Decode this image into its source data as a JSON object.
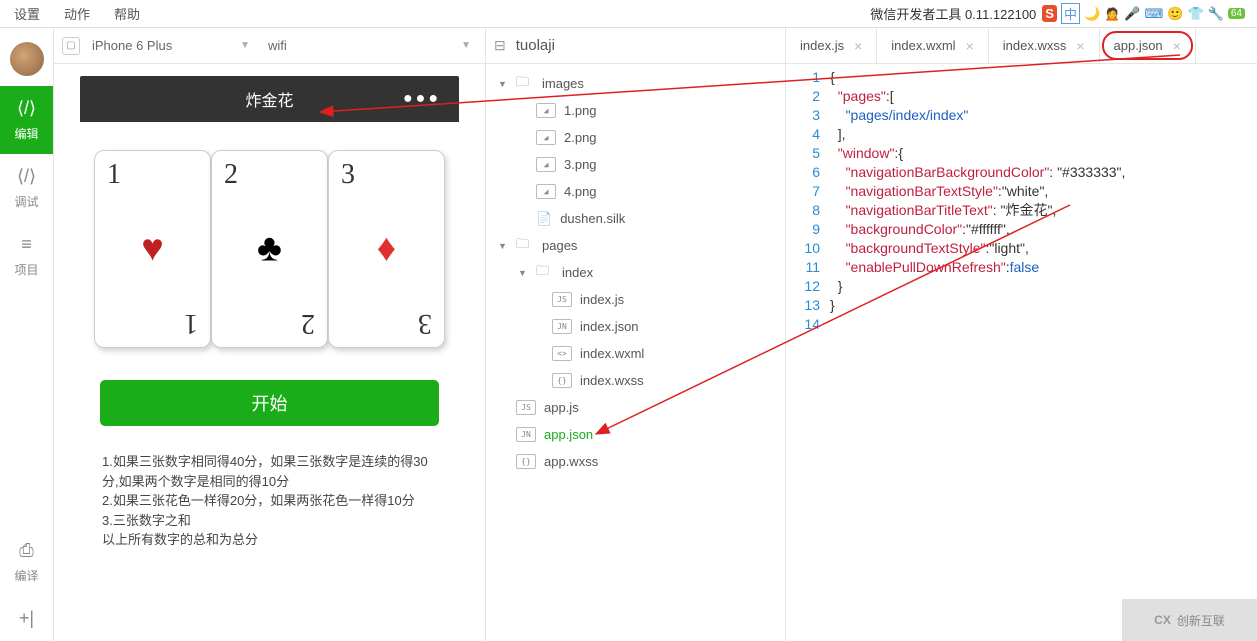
{
  "menubar": {
    "settings": "设置",
    "action": "动作",
    "help": "帮助",
    "title_info": "微信开发者工具 0.11.122100"
  },
  "sidebar": {
    "edit": "编辑",
    "debug": "调试",
    "project": "项目",
    "compile": "编译"
  },
  "preview": {
    "device": "iPhone 6 Plus",
    "network": "wifi"
  },
  "phone": {
    "title": "炸金花",
    "start_btn": "开始"
  },
  "cards": [
    {
      "num": "1",
      "suit": "♥",
      "cls": "suit-heart"
    },
    {
      "num": "2",
      "suit": "♣",
      "cls": "suit-club"
    },
    {
      "num": "3",
      "suit": "♦",
      "cls": "suit-diamond"
    }
  ],
  "rules": [
    "1.如果三张数字相同得40分，如果三张数字是连续的得30分,如果两个数字是相同的得10分",
    "2.如果三张花色一样得20分，如果两张花色一样得10分",
    "3.三张数字之和",
    "以上所有数字的总和为总分"
  ],
  "file_pane": {
    "title": "tuolaji"
  },
  "tree": {
    "images": "images",
    "img_children": [
      "1.png",
      "2.png",
      "3.png",
      "4.png",
      "dushen.silk"
    ],
    "pages": "pages",
    "index": "index",
    "index_children": [
      {
        "label": "index.js",
        "badge": "JS"
      },
      {
        "label": "index.json",
        "badge": "JN"
      },
      {
        "label": "index.wxml",
        "badge": "<>"
      },
      {
        "label": "index.wxss",
        "badge": "{}"
      }
    ],
    "root": [
      {
        "label": "app.js",
        "badge": "JS"
      },
      {
        "label": "app.json",
        "badge": "JN",
        "active": true
      },
      {
        "label": "app.wxss",
        "badge": "{}"
      }
    ]
  },
  "editor_tabs": [
    {
      "label": "index.js"
    },
    {
      "label": "index.wxml"
    },
    {
      "label": "index.wxss"
    },
    {
      "label": "app.json",
      "active": true
    }
  ],
  "code": [
    {
      "n": 1,
      "t": "{"
    },
    {
      "n": 2,
      "t": "  \"pages\":["
    },
    {
      "n": 3,
      "t": "    \"pages/index/index\""
    },
    {
      "n": 4,
      "t": "  ],"
    },
    {
      "n": 5,
      "t": "  \"window\":{"
    },
    {
      "n": 6,
      "t": "    \"navigationBarBackgroundColor\": \"#333333\","
    },
    {
      "n": 7,
      "t": "    \"navigationBarTextStyle\":\"white\","
    },
    {
      "n": 8,
      "t": "    \"navigationBarTitleText\": \"炸金花\","
    },
    {
      "n": 9,
      "t": "    \"backgroundColor\":\"#ffffff\","
    },
    {
      "n": 10,
      "t": "    \"backgroundTextStyle\":\"light\","
    },
    {
      "n": 11,
      "t": "    \"enablePullDownRefresh\":false"
    },
    {
      "n": 12,
      "t": "  }"
    },
    {
      "n": 13,
      "t": "}"
    },
    {
      "n": 14,
      "t": ""
    }
  ],
  "footer_logo": "创新互联"
}
